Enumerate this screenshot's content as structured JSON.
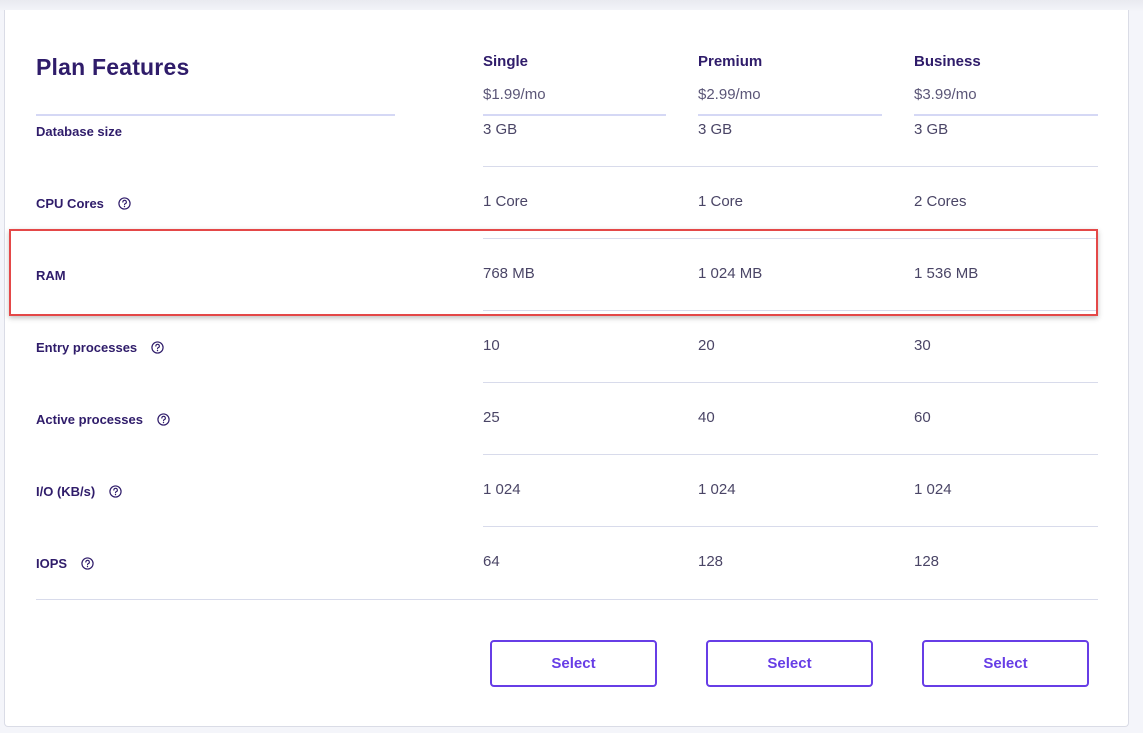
{
  "title": "Plan Features",
  "plans": [
    {
      "name": "Single",
      "price": "$1.99/mo",
      "button": "Select"
    },
    {
      "name": "Premium",
      "price": "$2.99/mo",
      "button": "Select"
    },
    {
      "name": "Business",
      "price": "$3.99/mo",
      "button": "Select"
    }
  ],
  "rows": [
    {
      "label": "Database size",
      "help": false,
      "values": [
        "3 GB",
        "3 GB",
        "3 GB"
      ]
    },
    {
      "label": "CPU Cores",
      "help": true,
      "values": [
        "1 Core",
        "1 Core",
        "2 Cores"
      ]
    },
    {
      "label": "RAM",
      "help": false,
      "highlighted": true,
      "values": [
        "768 MB",
        "1 024 MB",
        "1 536 MB"
      ]
    },
    {
      "label": "Entry processes",
      "help": true,
      "values": [
        "10",
        "20",
        "30"
      ]
    },
    {
      "label": "Active processes",
      "help": true,
      "values": [
        "25",
        "40",
        "60"
      ]
    },
    {
      "label": "I/O (KB/s)",
      "help": true,
      "values": [
        "1 024",
        "1 024",
        "1 024"
      ]
    },
    {
      "label": "IOPS",
      "help": true,
      "values": [
        "64",
        "128",
        "128"
      ]
    }
  ],
  "colors": {
    "accent": "#673de6",
    "text": "#2f1c6a",
    "highlight": "#e44848"
  },
  "icons": {
    "help": "question-circle-icon"
  }
}
